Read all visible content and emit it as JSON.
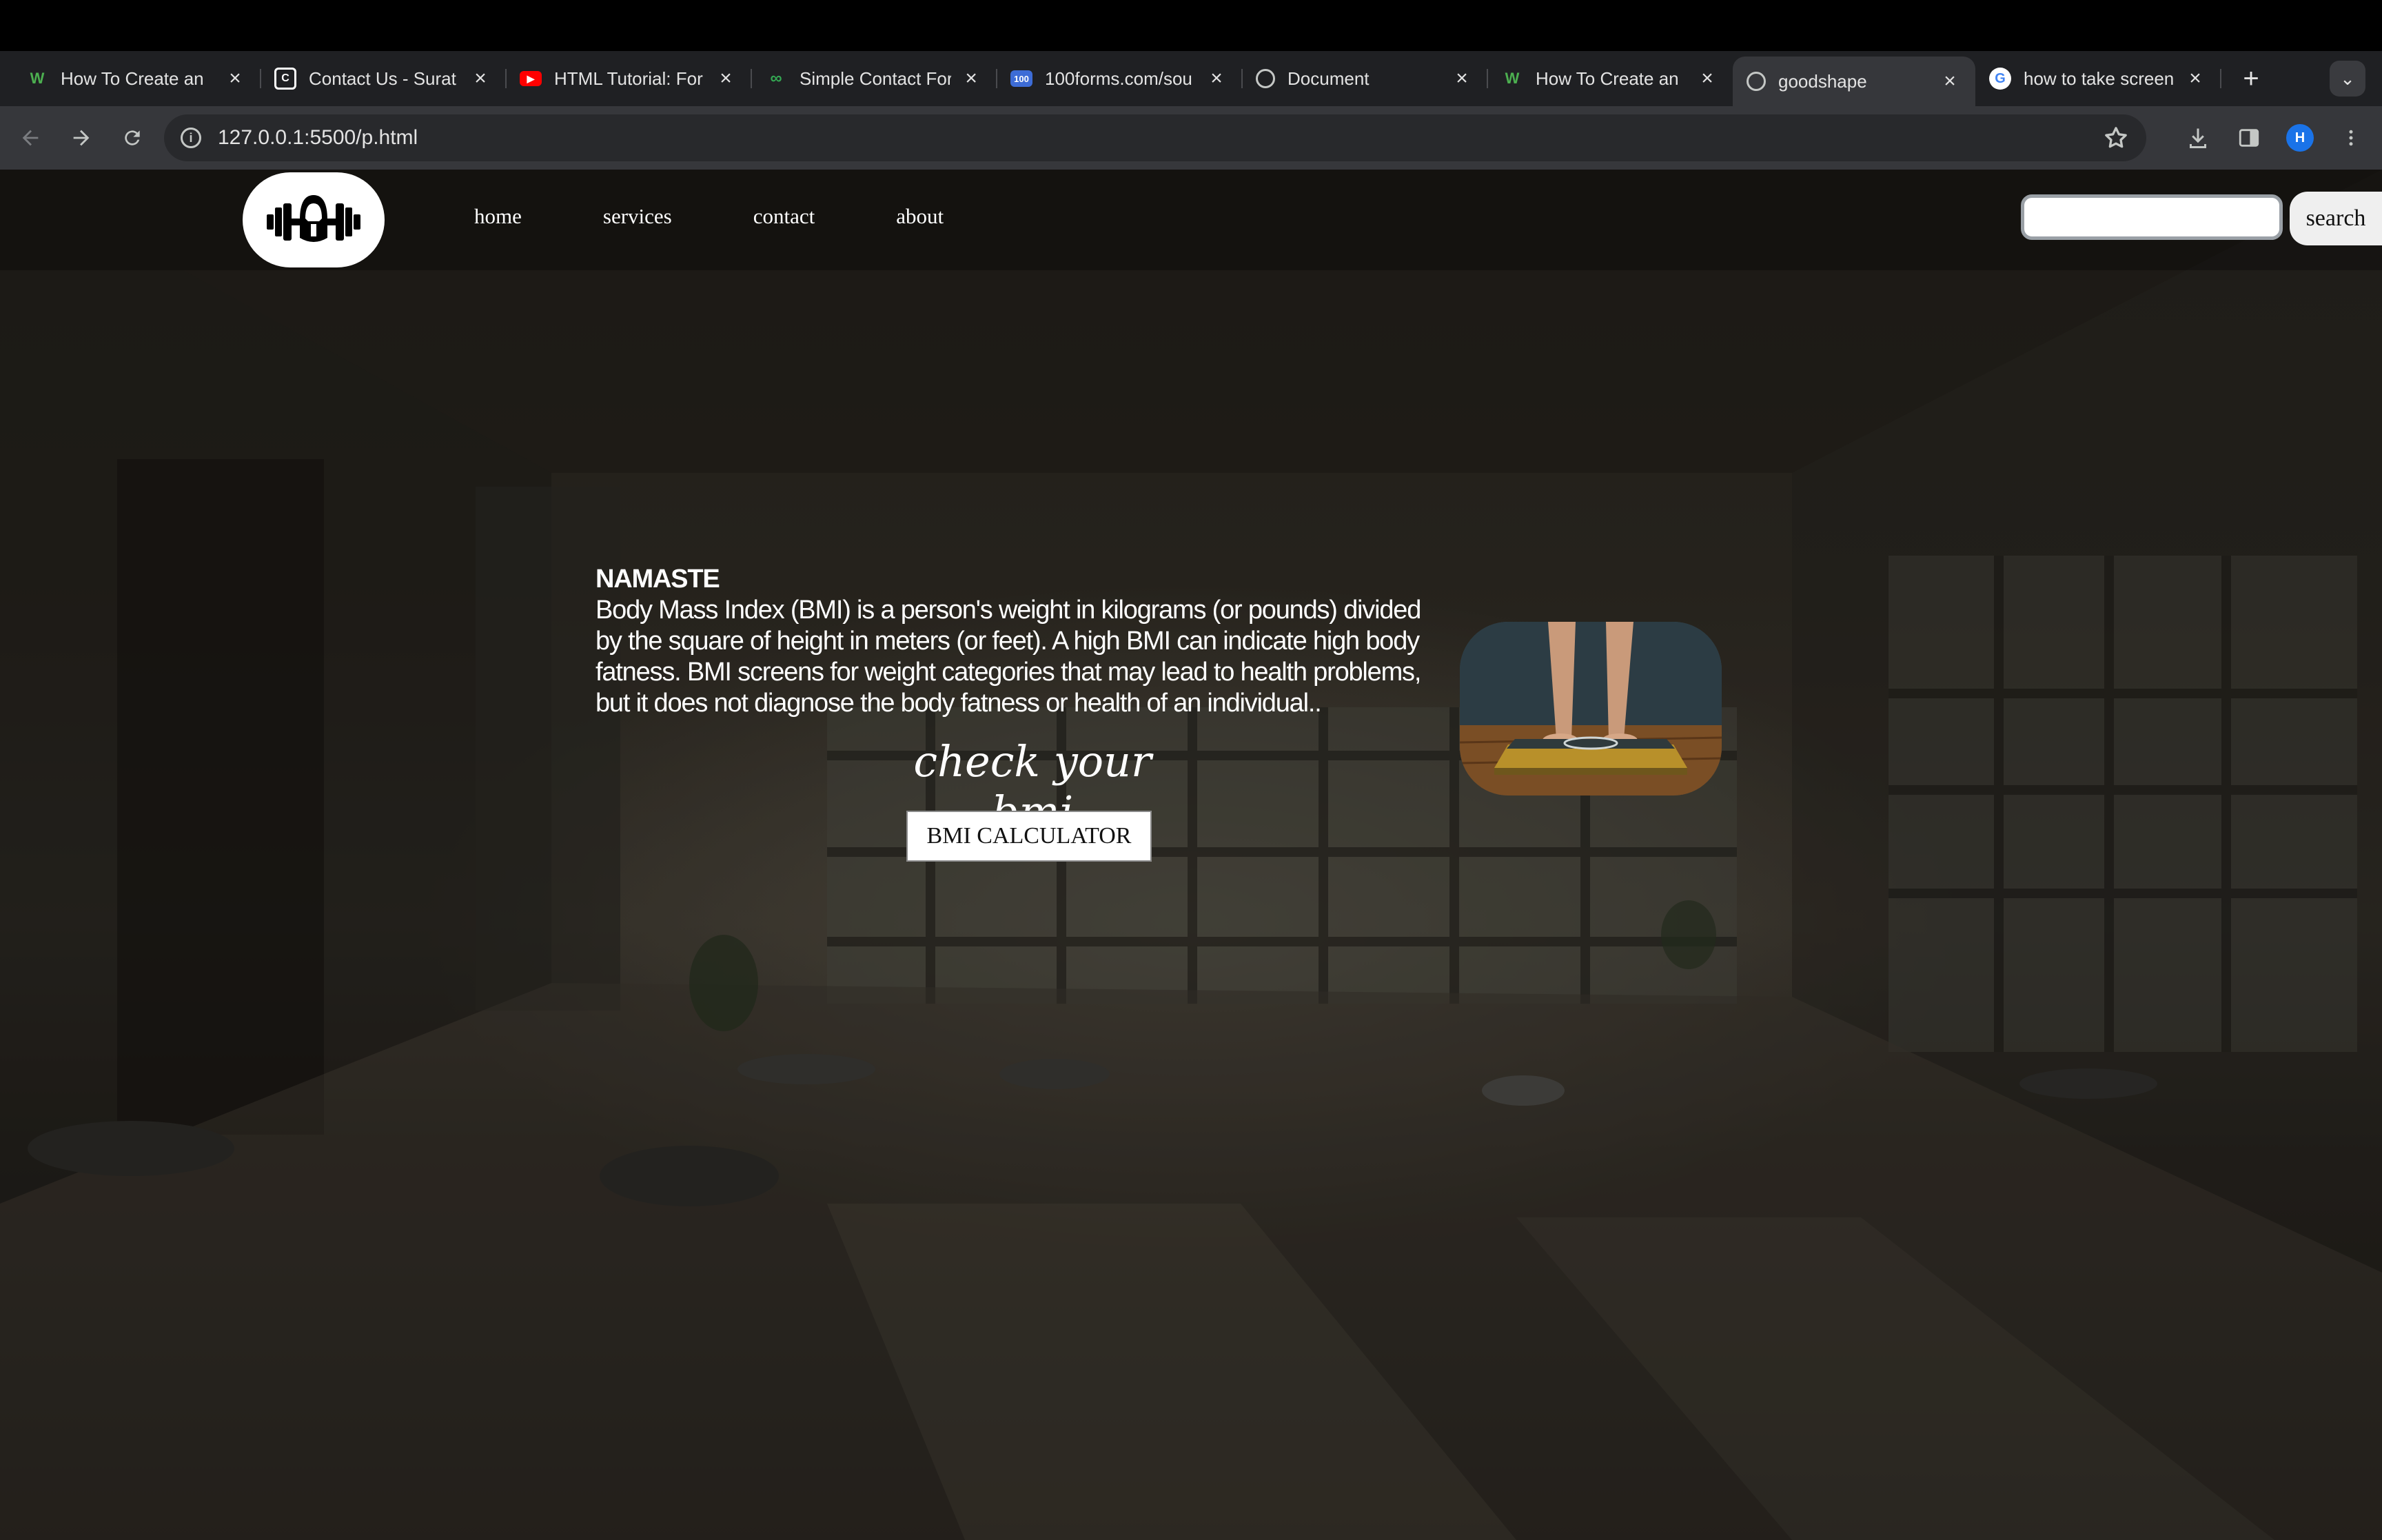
{
  "browser": {
    "tabs": [
      {
        "title": "How To Create an ",
        "favicon": "w-logo-icon",
        "fav_color": "#4caf50",
        "active": false
      },
      {
        "title": "Contact Us - Surat",
        "favicon": "bracket-logo-icon",
        "fav_color": "#ffffff",
        "active": false
      },
      {
        "title": "HTML Tutorial: For",
        "favicon": "youtube-icon",
        "fav_color": "#ff0000",
        "active": false
      },
      {
        "title": "Simple Contact For",
        "favicon": "chain-icon",
        "fav_color": "#34a853",
        "active": false
      },
      {
        "title": "100forms.com/sou",
        "favicon": "100-icon",
        "fav_color": "#3d6cd6",
        "active": false
      },
      {
        "title": "Document",
        "favicon": "globe-icon",
        "fav_color": "#c4c7c5",
        "active": false
      },
      {
        "title": "How To Create an ",
        "favicon": "w-logo-icon",
        "fav_color": "#4caf50",
        "active": false
      },
      {
        "title": "goodshape",
        "favicon": "globe-icon",
        "fav_color": "#c4c7c5",
        "active": true
      },
      {
        "title": "how to take screen",
        "favicon": "google-icon",
        "fav_color": "#4285f4",
        "active": false
      }
    ],
    "url": "127.0.0.1:5500/p.html",
    "profile_initial": "H"
  },
  "page": {
    "nav": {
      "links": [
        "home",
        "services",
        "contact",
        "about"
      ],
      "search_value": "",
      "search_button": "search"
    },
    "hero": {
      "heading": "NAMASTE",
      "paragraph": "Body Mass Index (BMI) is a person's weight in kilograms (or pounds) divided by the square of height in meters (or feet). A high BMI can indicate high body fatness. BMI screens for weight categories that may lead to health problems, but it does not diagnose the body fatness or health of an individual..",
      "cta_title": "check your bmi",
      "cta_button": "BMI CALCULATOR"
    },
    "colors": {
      "background": "#2e2a23",
      "text": "#ffffff",
      "button_bg": "#ffffff"
    }
  }
}
